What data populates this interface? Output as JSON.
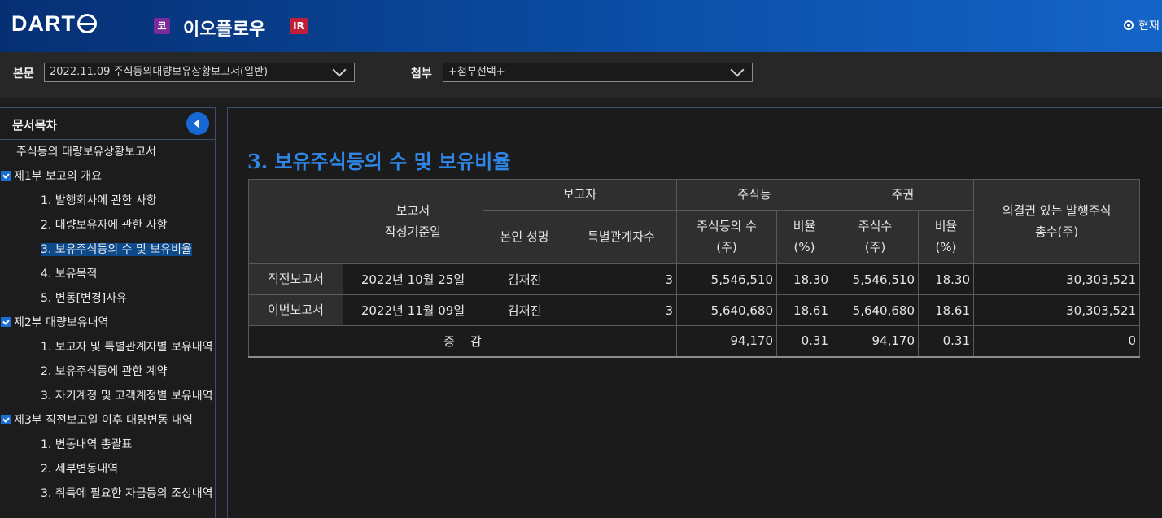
{
  "header": {
    "logo": "DART",
    "market_badge": "코",
    "company": "이오플로우",
    "ir_badge": "IR",
    "radio_label": "현재"
  },
  "selbar": {
    "main_label": "본문",
    "main_value": "2022.11.09  주식등의대량보유상황보고서(일반)",
    "attach_label": "첨부",
    "attach_value": "+첨부선택+"
  },
  "sidebar": {
    "title": "문서목차",
    "items": [
      {
        "label": "주식등의 대량보유상황보고서",
        "level": 0,
        "checked": false,
        "selected": false
      },
      {
        "label": "제1부 보고의 개요",
        "level": 0,
        "checked": true,
        "selected": false
      },
      {
        "label": "1. 발행회사에 관한 사항",
        "level": 1,
        "checked": false,
        "selected": false
      },
      {
        "label": "2. 대량보유자에 관한 사항",
        "level": 1,
        "checked": false,
        "selected": false
      },
      {
        "label": "3. 보유주식등의 수 및 보유비율",
        "level": 1,
        "checked": false,
        "selected": true
      },
      {
        "label": "4. 보유목적",
        "level": 1,
        "checked": false,
        "selected": false
      },
      {
        "label": "5. 변동[변경]사유",
        "level": 1,
        "checked": false,
        "selected": false
      },
      {
        "label": "제2부 대량보유내역",
        "level": 0,
        "checked": true,
        "selected": false
      },
      {
        "label": "1. 보고자 및 특별관계자별 보유내역",
        "level": 1,
        "checked": false,
        "selected": false
      },
      {
        "label": "2. 보유주식등에 관한 계약",
        "level": 1,
        "checked": false,
        "selected": false
      },
      {
        "label": "3. 자기계정 및 고객계정별 보유내역",
        "level": 1,
        "checked": false,
        "selected": false
      },
      {
        "label": "제3부 직전보고일 이후 대량변동 내역",
        "level": 0,
        "checked": true,
        "selected": false
      },
      {
        "label": "1. 변동내역 총괄표",
        "level": 1,
        "checked": false,
        "selected": false
      },
      {
        "label": "2. 세부변동내역",
        "level": 1,
        "checked": false,
        "selected": false
      },
      {
        "label": "3. 취득에 필요한 자금등의 조성내역",
        "level": 1,
        "checked": false,
        "selected": false
      }
    ]
  },
  "main": {
    "section_title": "3. 보유주식등의 수 및 보유비율",
    "table": {
      "h_report_date_1": "보고서",
      "h_report_date_2": "작성기준일",
      "h_reporter": "보고자",
      "h_shares": "주식등",
      "h_stock": "주권",
      "h_total_1": "의결권 있는 발행주식",
      "h_total_2": "총수(주)",
      "h_name": "본인 성명",
      "h_related": "특별관계자수",
      "h_share_count_1": "주식등의 수",
      "h_share_count_2": "(주)",
      "h_ratio_1": "비율",
      "h_ratio_2": "(%)",
      "h_stock_count_1": "주식수",
      "h_stock_count_2": "(주)",
      "h_ratio2_1": "비율",
      "h_ratio2_2": "(%)",
      "rows": [
        {
          "type": "직전보고서",
          "date": "2022년 10월 25일",
          "name": "김재진",
          "related": "3",
          "shares": "5,546,510",
          "ratio": "18.30",
          "stock": "5,546,510",
          "stock_ratio": "18.30",
          "total": "30,303,521"
        },
        {
          "type": "이번보고서",
          "date": "2022년 11월 09일",
          "name": "김재진",
          "related": "3",
          "shares": "5,640,680",
          "ratio": "18.61",
          "stock": "5,640,680",
          "stock_ratio": "18.61",
          "total": "30,303,521"
        }
      ],
      "diff": {
        "label": "증    감",
        "shares": "94,170",
        "ratio": "0.31",
        "stock": "94,170",
        "stock_ratio": "0.31",
        "total": "0"
      }
    }
  }
}
